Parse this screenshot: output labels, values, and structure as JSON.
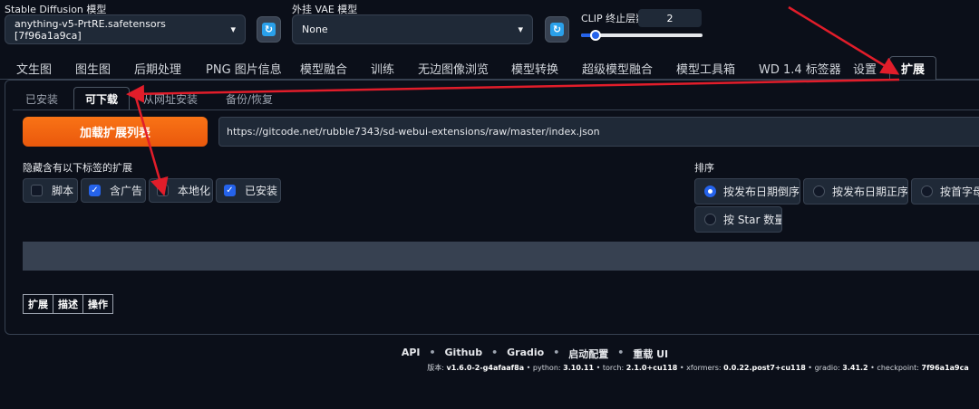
{
  "header": {
    "model_label": "Stable Diffusion 模型",
    "model_value": "anything-v5-PrtRE.safetensors [7f96a1a9ca]",
    "vae_label": "外挂 VAE 模型",
    "vae_value": "None",
    "clip_label": "CLIP 终止层数",
    "clip_value": "2",
    "refresh_icon": "refresh-icon"
  },
  "main_tabs": [
    "文生图",
    "图生图",
    "后期处理",
    "PNG 图片信息",
    "模型融合",
    "训练",
    "无边图像浏览",
    "模型转换",
    "超级模型融合",
    "模型工具箱",
    "WD 1.4 标签器",
    "设置",
    "扩展"
  ],
  "sub_tabs": [
    "已安装",
    "可下载",
    "从网址安装",
    "备份/恢复"
  ],
  "load_button": "加载扩展列表",
  "url_value": "https://gitcode.net/rubble7343/sd-webui-extensions/raw/master/index.json",
  "hide_label": "隐藏含有以下标签的扩展",
  "hide_tags": [
    {
      "label": "脚本",
      "checked": false
    },
    {
      "label": "含广告",
      "checked": true
    },
    {
      "label": "本地化",
      "checked": false
    },
    {
      "label": "已安装",
      "checked": true
    }
  ],
  "sort_label": "排序",
  "sort_options": [
    {
      "label": "按发布日期倒序",
      "selected": true
    },
    {
      "label": "按发布日期正序",
      "selected": false
    },
    {
      "label": "按首字母正序",
      "selected": false
    },
    {
      "label": "按 Star 数量",
      "selected": false
    }
  ],
  "table_headers": [
    "扩展",
    "描述",
    "操作"
  ],
  "footer": {
    "links": [
      "API",
      "Github",
      "Gradio",
      "启动配置",
      "重载 UI"
    ],
    "version_prefix": "版本: ",
    "version": "v1.6.0-2-g4afaaf8a",
    "python_label": " • python: ",
    "python": "3.10.11",
    "torch_label": " • torch: ",
    "torch": "2.1.0+cu118",
    "xformers_label": " • xformers: ",
    "xformers": "0.0.22.post7+cu118",
    "gradio_label": " • gradio: ",
    "gradio": "3.41.2",
    "checkpoint_label": " • checkpoint: ",
    "checkpoint": "7f96a1a9ca"
  },
  "colors": {
    "accent": "#2563eb",
    "orange": "#f97316",
    "arrow": "#e11d2a",
    "bg": "#0b0f19"
  }
}
